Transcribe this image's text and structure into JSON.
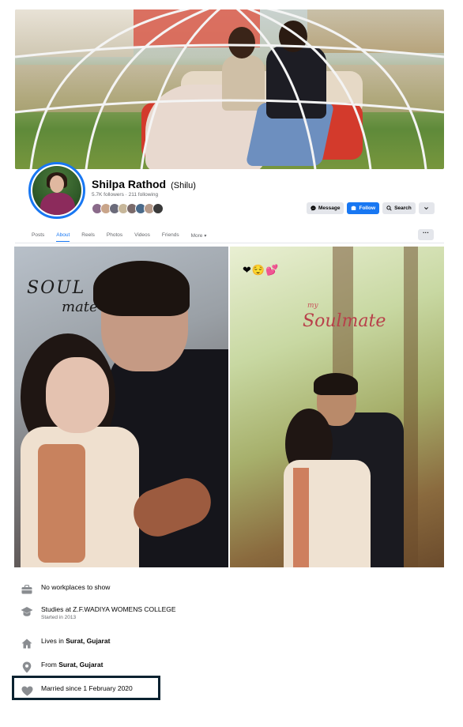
{
  "profile": {
    "name": "Shilpa Rathod",
    "nickname": "(Shilu)",
    "followers": "5.7K followers",
    "following": "211 following",
    "friend_avatar_colors": [
      "#8a6a8a",
      "#c9a58a",
      "#6b6b7a",
      "#c7b79a",
      "#7a6a6a",
      "#4a6a8a",
      "#b59a8a",
      "#3a3a3a"
    ]
  },
  "actions": {
    "message": "Message",
    "follow": "Follow",
    "search": "Search"
  },
  "tabs": [
    "Posts",
    "About",
    "Reels",
    "Photos",
    "Videos",
    "Friends",
    "More"
  ],
  "active_tab": "About",
  "photos": {
    "left_overlay_line1": "SOUL",
    "left_overlay_line2": "mate",
    "right_overlay_emojis": "❤😌💕",
    "right_overlay_small": "my",
    "right_overlay_main": "Soulmate"
  },
  "about": {
    "work": "No workplaces to show",
    "education_prefix": "Studies at ",
    "education_school": "Z.F.WADIYA WOMENS COLLEGE",
    "education_started": "Started in 2013",
    "lives_prefix": "Lives in ",
    "lives_place": "Surat, Gujarat",
    "from_prefix": "From ",
    "from_place": "Surat, Gujarat",
    "relationship": "Married since 1 February 2020"
  },
  "colors": {
    "accent": "#1877f2",
    "secondary_text": "#65676b",
    "button_grey": "#e4e6eb",
    "highlight_border": "#0a2230"
  }
}
